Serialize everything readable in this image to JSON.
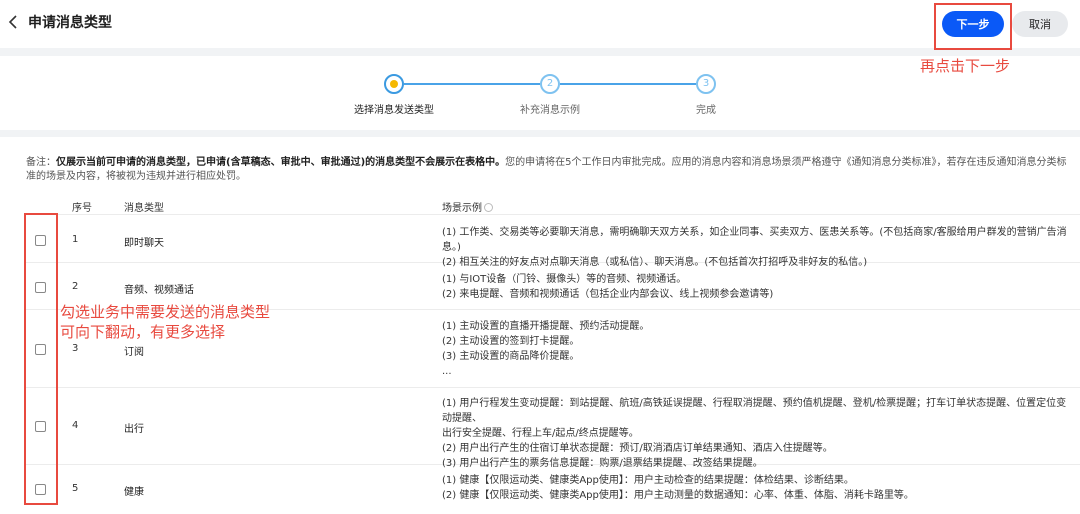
{
  "header": {
    "title": "申请消息类型",
    "next_label": "下一步",
    "cancel_label": "取消",
    "accent_color": "#0a59f7"
  },
  "annotations": {
    "next_hint": "再点击下一步",
    "check_hint_line1": "勾选业务中需要发送的消息类型",
    "check_hint_line2": "可向下翻动，有更多选择",
    "highlight_color": "#e84a3f"
  },
  "steps": [
    {
      "number": "",
      "label": "选择消息发送类型",
      "state": "active"
    },
    {
      "number": "2",
      "label": "补充消息示例",
      "state": "pending"
    },
    {
      "number": "3",
      "label": "完成",
      "state": "pending"
    }
  ],
  "note": {
    "prefix": "备注：",
    "bold": "仅展示当前可申请的消息类型，已申请(含草稿态、审批中、审批通过)的消息类型不会展示在表格中。",
    "rest": "您的申请将在5个工作日内审批完成。应用的消息内容和消息场景须严格遵守《通知消息分类标准》，若存在违反通知消息分类标准的场景及内容，将被视为违规并进行相应处罚。"
  },
  "table": {
    "columns": {
      "seq": "序号",
      "type": "消息类型",
      "example": "场景示例"
    },
    "rows": [
      {
        "seq": "1",
        "type": "即时聊天",
        "lines": [
          "(1) 工作类、交易类等必要聊天消息，需明确聊天双方关系，如企业同事、买卖双方、医患关系等。(不包括商家/客服给用户群发的营销广告消息。)",
          "(2) 相互关注的好友点对点聊天消息（或私信）、聊天消息。(不包括首次打招呼及非好友的私信。)"
        ]
      },
      {
        "seq": "2",
        "type": "音频、视频通话",
        "lines": [
          "(1) 与IOT设备（门铃、摄像头）等的音频、视频通话。",
          "(2) 来电提醒、音频和视频通话（包括企业内部会议、线上视频参会邀请等)"
        ]
      },
      {
        "seq": "3",
        "type": "订阅",
        "lines": [
          "(1) 主动设置的直播开播提醒、预约活动提醒。",
          "(2) 主动设置的签到打卡提醒。",
          "(3) 主动设置的商品降价提醒。",
          "..."
        ]
      },
      {
        "seq": "4",
        "type": "出行",
        "lines": [
          "(1) 用户行程发生变动提醒：到站提醒、航班/高铁延误提醒、行程取消提醒、预约值机提醒、登机/检票提醒；打车订单状态提醒、位置定位变动提醒、",
          "出行安全提醒、行程上车/起点/终点提醒等。",
          "(2) 用户出行产生的住宿订单状态提醒：预订/取消酒店订单结果通知、酒店入住提醒等。",
          "(3) 用户出行产生的票务信息提醒：购票/退票结果提醒、改签结果提醒。"
        ]
      },
      {
        "seq": "5",
        "type": "健康",
        "lines": [
          "(1) 健康【仅限运动类、健康类App使用】：用户主动检查的结果提醒：体检结果、诊断结果。",
          "(2) 健康【仅限运动类、健康类App使用】：用户主动测量的数据通知：心率、体重、体脂、消耗卡路里等。"
        ]
      }
    ]
  }
}
